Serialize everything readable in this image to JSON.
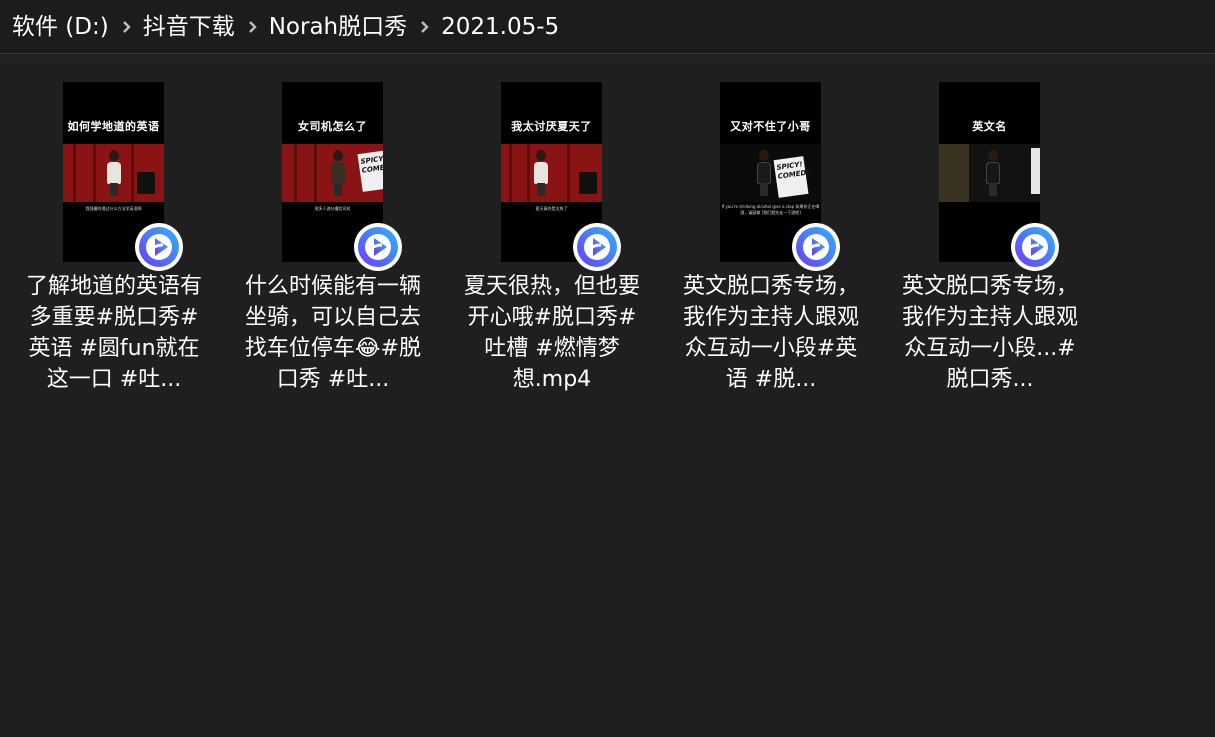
{
  "breadcrumb": [
    "软件 (D:)",
    "抖音下载",
    "Norah脱口秀",
    "2021.05-5"
  ],
  "colors": {
    "background": "#1f1f1f",
    "addressbar": "#1c1c1c",
    "text": "#ffffff",
    "stage_red": "#8a1414"
  },
  "files": [
    {
      "thumb_title": "如何学地道的英语",
      "thumb_caption": "我强最吹通过什么方法学英语啊",
      "label": "了解地道的英语有多重要#脱口秀#英语 #圆fun就在这一口 #吐...",
      "icon": "video-app-icon"
    },
    {
      "thumb_title": "女司机怎么了",
      "thumb_caption": "很多人说吐槽女司机",
      "thumb_sign": "SPICY! COMEDY",
      "label": "什么时候能有一辆坐骑，可以自己去找车位停车😂#脱口秀 #吐...",
      "icon": "video-app-icon"
    },
    {
      "thumb_title": "我太讨厌夏天了",
      "thumb_caption": "夏天真的是太热了",
      "label": "夏天很热，但也要开心哦#脱口秀#吐槽 #燃情梦想.mp4",
      "icon": "video-app-icon"
    },
    {
      "thumb_title": "又对不住了小哥",
      "thumb_caption": "If you're drinking alcohol give a clap 如果你正在喝酒，请鼓掌 [我们就先走一下酒吧]",
      "thumb_sign": "SPICY! COMEDY",
      "label": "英文脱口秀专场，我作为主持人跟观众互动一小段#英语 #脱...",
      "icon": "video-app-icon"
    },
    {
      "thumb_title": "英文名",
      "thumb_caption": "",
      "label": "英文脱口秀专场，我作为主持人跟观众互动一小段...#脱口秀...",
      "icon": "video-app-icon"
    }
  ]
}
